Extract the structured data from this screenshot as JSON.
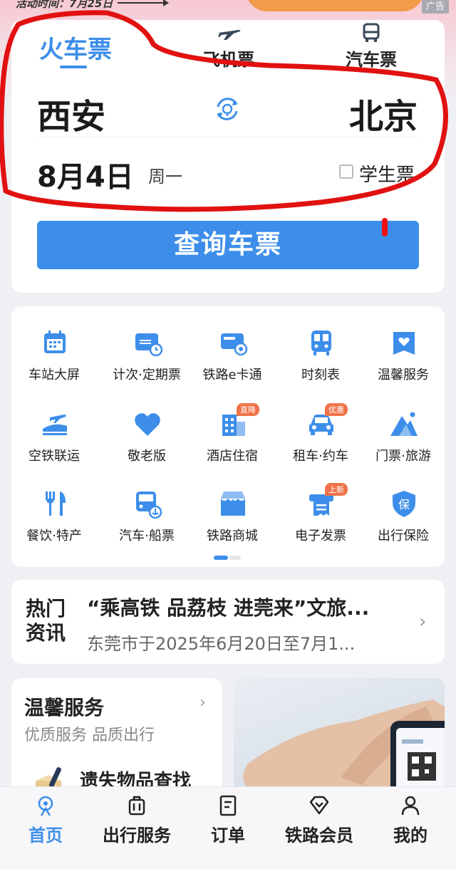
{
  "promo": {
    "text": "活动时间：7月25日",
    "ad_label": "广告"
  },
  "tabs": [
    {
      "label": "火车票",
      "active": true,
      "icon": "train-logo"
    },
    {
      "label": "飞机票",
      "active": false,
      "icon": "plane-icon"
    },
    {
      "label": "汽车票",
      "active": false,
      "icon": "bus-icon"
    }
  ],
  "route": {
    "from": "西安",
    "to": "北京",
    "swap_icon": "swap-icon"
  },
  "date": {
    "value": "8月4日",
    "weekday": "周一",
    "student_label": "学生票",
    "student_checked": false
  },
  "search_button": "查询车票",
  "services": [
    {
      "label": "车站大屏",
      "icon": "calendar-icon"
    },
    {
      "label": "计次·定期票",
      "icon": "card-clock-icon"
    },
    {
      "label": "铁路e卡通",
      "icon": "ecard-icon"
    },
    {
      "label": "时刻表",
      "icon": "timetable-icon"
    },
    {
      "label": "温馨服务",
      "icon": "heart-tag-icon"
    },
    {
      "label": "空铁联运",
      "icon": "plane-train-icon"
    },
    {
      "label": "敬老版",
      "icon": "heart-icon"
    },
    {
      "label": "酒店住宿",
      "icon": "hotel-icon",
      "badge": "直降"
    },
    {
      "label": "租车·约车",
      "icon": "car-icon",
      "badge": "优惠"
    },
    {
      "label": "门票·旅游",
      "icon": "mountain-icon"
    },
    {
      "label": "餐饮·特产",
      "icon": "food-icon"
    },
    {
      "label": "汽车·船票",
      "icon": "bus-ship-icon"
    },
    {
      "label": "铁路商城",
      "icon": "shop-icon"
    },
    {
      "label": "电子发票",
      "icon": "invoice-icon",
      "badge": "上新"
    },
    {
      "label": "出行保险",
      "icon": "insurance-icon"
    }
  ],
  "news": {
    "tag_line1": "热门",
    "tag_line2": "资讯",
    "title": "“乘高铁 品荔枝 进莞来”文旅...",
    "subtitle": "东莞市于2025年6月20日至7月1..."
  },
  "warm": {
    "title": "温馨服务",
    "subtitle": "优质服务 品质出行",
    "item": "遗失物品查找"
  },
  "nav": [
    {
      "label": "首页",
      "icon": "home-rail-icon",
      "active": true
    },
    {
      "label": "出行服务",
      "icon": "luggage-icon",
      "active": false
    },
    {
      "label": "订单",
      "icon": "order-icon",
      "active": false
    },
    {
      "label": "铁路会员",
      "icon": "diamond-icon",
      "active": false
    },
    {
      "label": "我的",
      "icon": "user-icon",
      "active": false
    }
  ],
  "colors": {
    "accent": "#3d8eea",
    "annotation": "#e11111",
    "badge": "#f0734a"
  }
}
